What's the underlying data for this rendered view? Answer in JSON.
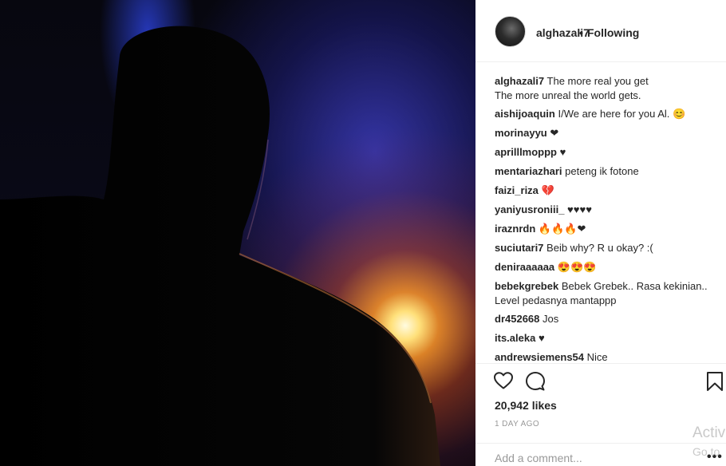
{
  "post": {
    "username": "alghazali7",
    "dot": "•",
    "follow_state": "Following",
    "caption_user": "alghazali7",
    "caption_line1": "The more real you get",
    "caption_line2": "The more unreal the world gets."
  },
  "comments": [
    {
      "user": "aishijoaquin",
      "text": "I/We are here for you Al. 😊"
    },
    {
      "user": "morinayyu",
      "text": "❤"
    },
    {
      "user": "aprilllmoppp",
      "text": "♥"
    },
    {
      "user": "mentariazhari",
      "text": "peteng ik fotone"
    },
    {
      "user": "faizi_riza",
      "text": "💔"
    },
    {
      "user": "yaniyusroniii_",
      "text": "♥♥♥♥"
    },
    {
      "user": "iraznrdn",
      "text": "🔥🔥🔥❤"
    },
    {
      "user": "suciutari7",
      "text": "Beib why? R u okay? :("
    },
    {
      "user": "deniraaaaaa",
      "text": "😍😍😍"
    },
    {
      "user": "bebekgrebek",
      "text": "Bebek Grebek.. Rasa kekinian..",
      "text2": "Level pedasnya mantappp"
    },
    {
      "user": "dr452668",
      "text": "Jos"
    },
    {
      "user": "its.aleka",
      "text": "♥"
    },
    {
      "user": "andrewsiemens54",
      "text": "Nice"
    }
  ],
  "likes": "20,942 likes",
  "time_ago": "1 DAY AGO",
  "comment_input": {
    "placeholder": "Add a comment..."
  },
  "more_label": "•••",
  "watermark": {
    "line1": "Activ",
    "line2": "Go to"
  },
  "icons": {
    "like": "heart-outline-icon",
    "comment": "speech-bubble-icon",
    "save": "bookmark-icon"
  },
  "colors": {
    "heart_red": "#ed2d3f",
    "text": "#262626",
    "muted": "#999999",
    "divider": "#efefef"
  }
}
